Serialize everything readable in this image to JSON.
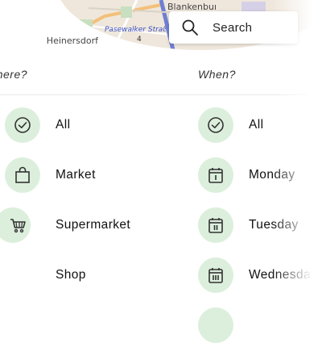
{
  "map": {
    "labels": [
      "Blankenburg",
      "Pasewalker Straße",
      "Heinersdorf"
    ],
    "route_number": "4"
  },
  "search": {
    "label": "Search"
  },
  "where": {
    "header": "Where?",
    "items": [
      {
        "label": "All",
        "icon": "check-circle-icon"
      },
      {
        "label": "Market",
        "icon": "bag-icon"
      },
      {
        "label": "Supermarket",
        "icon": "cart-icon"
      },
      {
        "label": "Shop",
        "icon": "shop-icon"
      }
    ]
  },
  "when": {
    "header": "When?",
    "items": [
      {
        "label": "All",
        "icon": "check-circle-icon"
      },
      {
        "label": "Monday",
        "icon": "calendar-i-icon"
      },
      {
        "label": "Tuesday",
        "icon": "calendar-ii-icon"
      },
      {
        "label": "Wednesday",
        "icon": "calendar-iii-icon"
      }
    ]
  },
  "colors": {
    "accent_circle": "#dcefdc",
    "icon_stroke": "#333333",
    "text": "#111111"
  }
}
